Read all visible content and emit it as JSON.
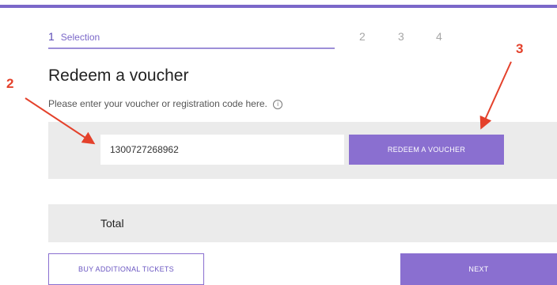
{
  "steps": {
    "current_number": "1",
    "current_label": "Selection",
    "others": [
      "2",
      "3",
      "4"
    ]
  },
  "page_title": "Redeem a voucher",
  "hint_text": "Please enter your voucher or registration code here.",
  "info_symbol": "i",
  "voucher": {
    "value": "1300727268962",
    "button_label": "REDEEM A VOUCHER"
  },
  "total_label": "Total",
  "footer": {
    "buy_label": "BUY ADDITIONAL TICKETS",
    "next_label": "NEXT"
  },
  "annotations": {
    "a2": "2",
    "a3": "3",
    "color": "#e4412b"
  },
  "colors": {
    "accent": "#8a6fd0",
    "panel": "#ebebeb"
  }
}
